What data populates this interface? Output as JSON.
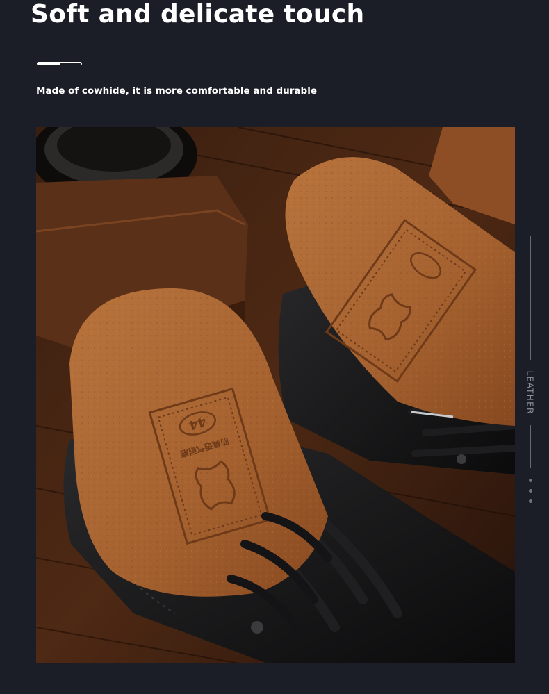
{
  "header": {
    "title": "Soft and delicate touch",
    "subtitle": "Made of cowhide, it is more comfortable and durable"
  },
  "progress": {
    "fraction": 0.5
  },
  "side_label": "LEATHER",
  "photo": {
    "insole_stamp": {
      "size": "44",
      "text": "防臭透气耐磨"
    }
  },
  "colors": {
    "background": "#1b1e26",
    "text": "#ffffff",
    "rail": "#646a78",
    "leather": "#a4612f"
  }
}
